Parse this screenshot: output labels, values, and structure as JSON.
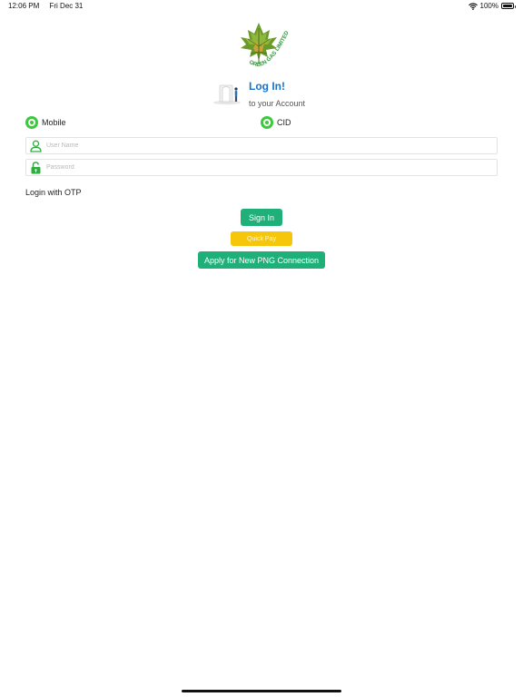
{
  "status_bar": {
    "time": "12:06 PM",
    "date": "Fri Dec 31",
    "battery": "100%",
    "battery_level": 1.0
  },
  "logo": {
    "text": "GREEN GAS LIMITED"
  },
  "header": {
    "title": "Log In!",
    "subtitle": "to your Account"
  },
  "login_type": {
    "options": [
      "Mobile",
      "CID"
    ]
  },
  "fields": {
    "username": {
      "placeholder": "User Name",
      "value": ""
    },
    "password": {
      "placeholder": "Password",
      "value": ""
    }
  },
  "otp_link": "Login with OTP",
  "buttons": {
    "sign_in": "Sign In",
    "quick_pay": "Quick Pay",
    "new_connection": "Apply for New PNG Connection"
  },
  "colors": {
    "accent_green": "#1fb07a",
    "radio_green": "#3cc93c",
    "title_blue": "#1a73c9",
    "quick_pay_yellow": "#f5c60a"
  },
  "icons": [
    "wifi-icon",
    "battery-icon",
    "user-icon",
    "lock-icon"
  ]
}
